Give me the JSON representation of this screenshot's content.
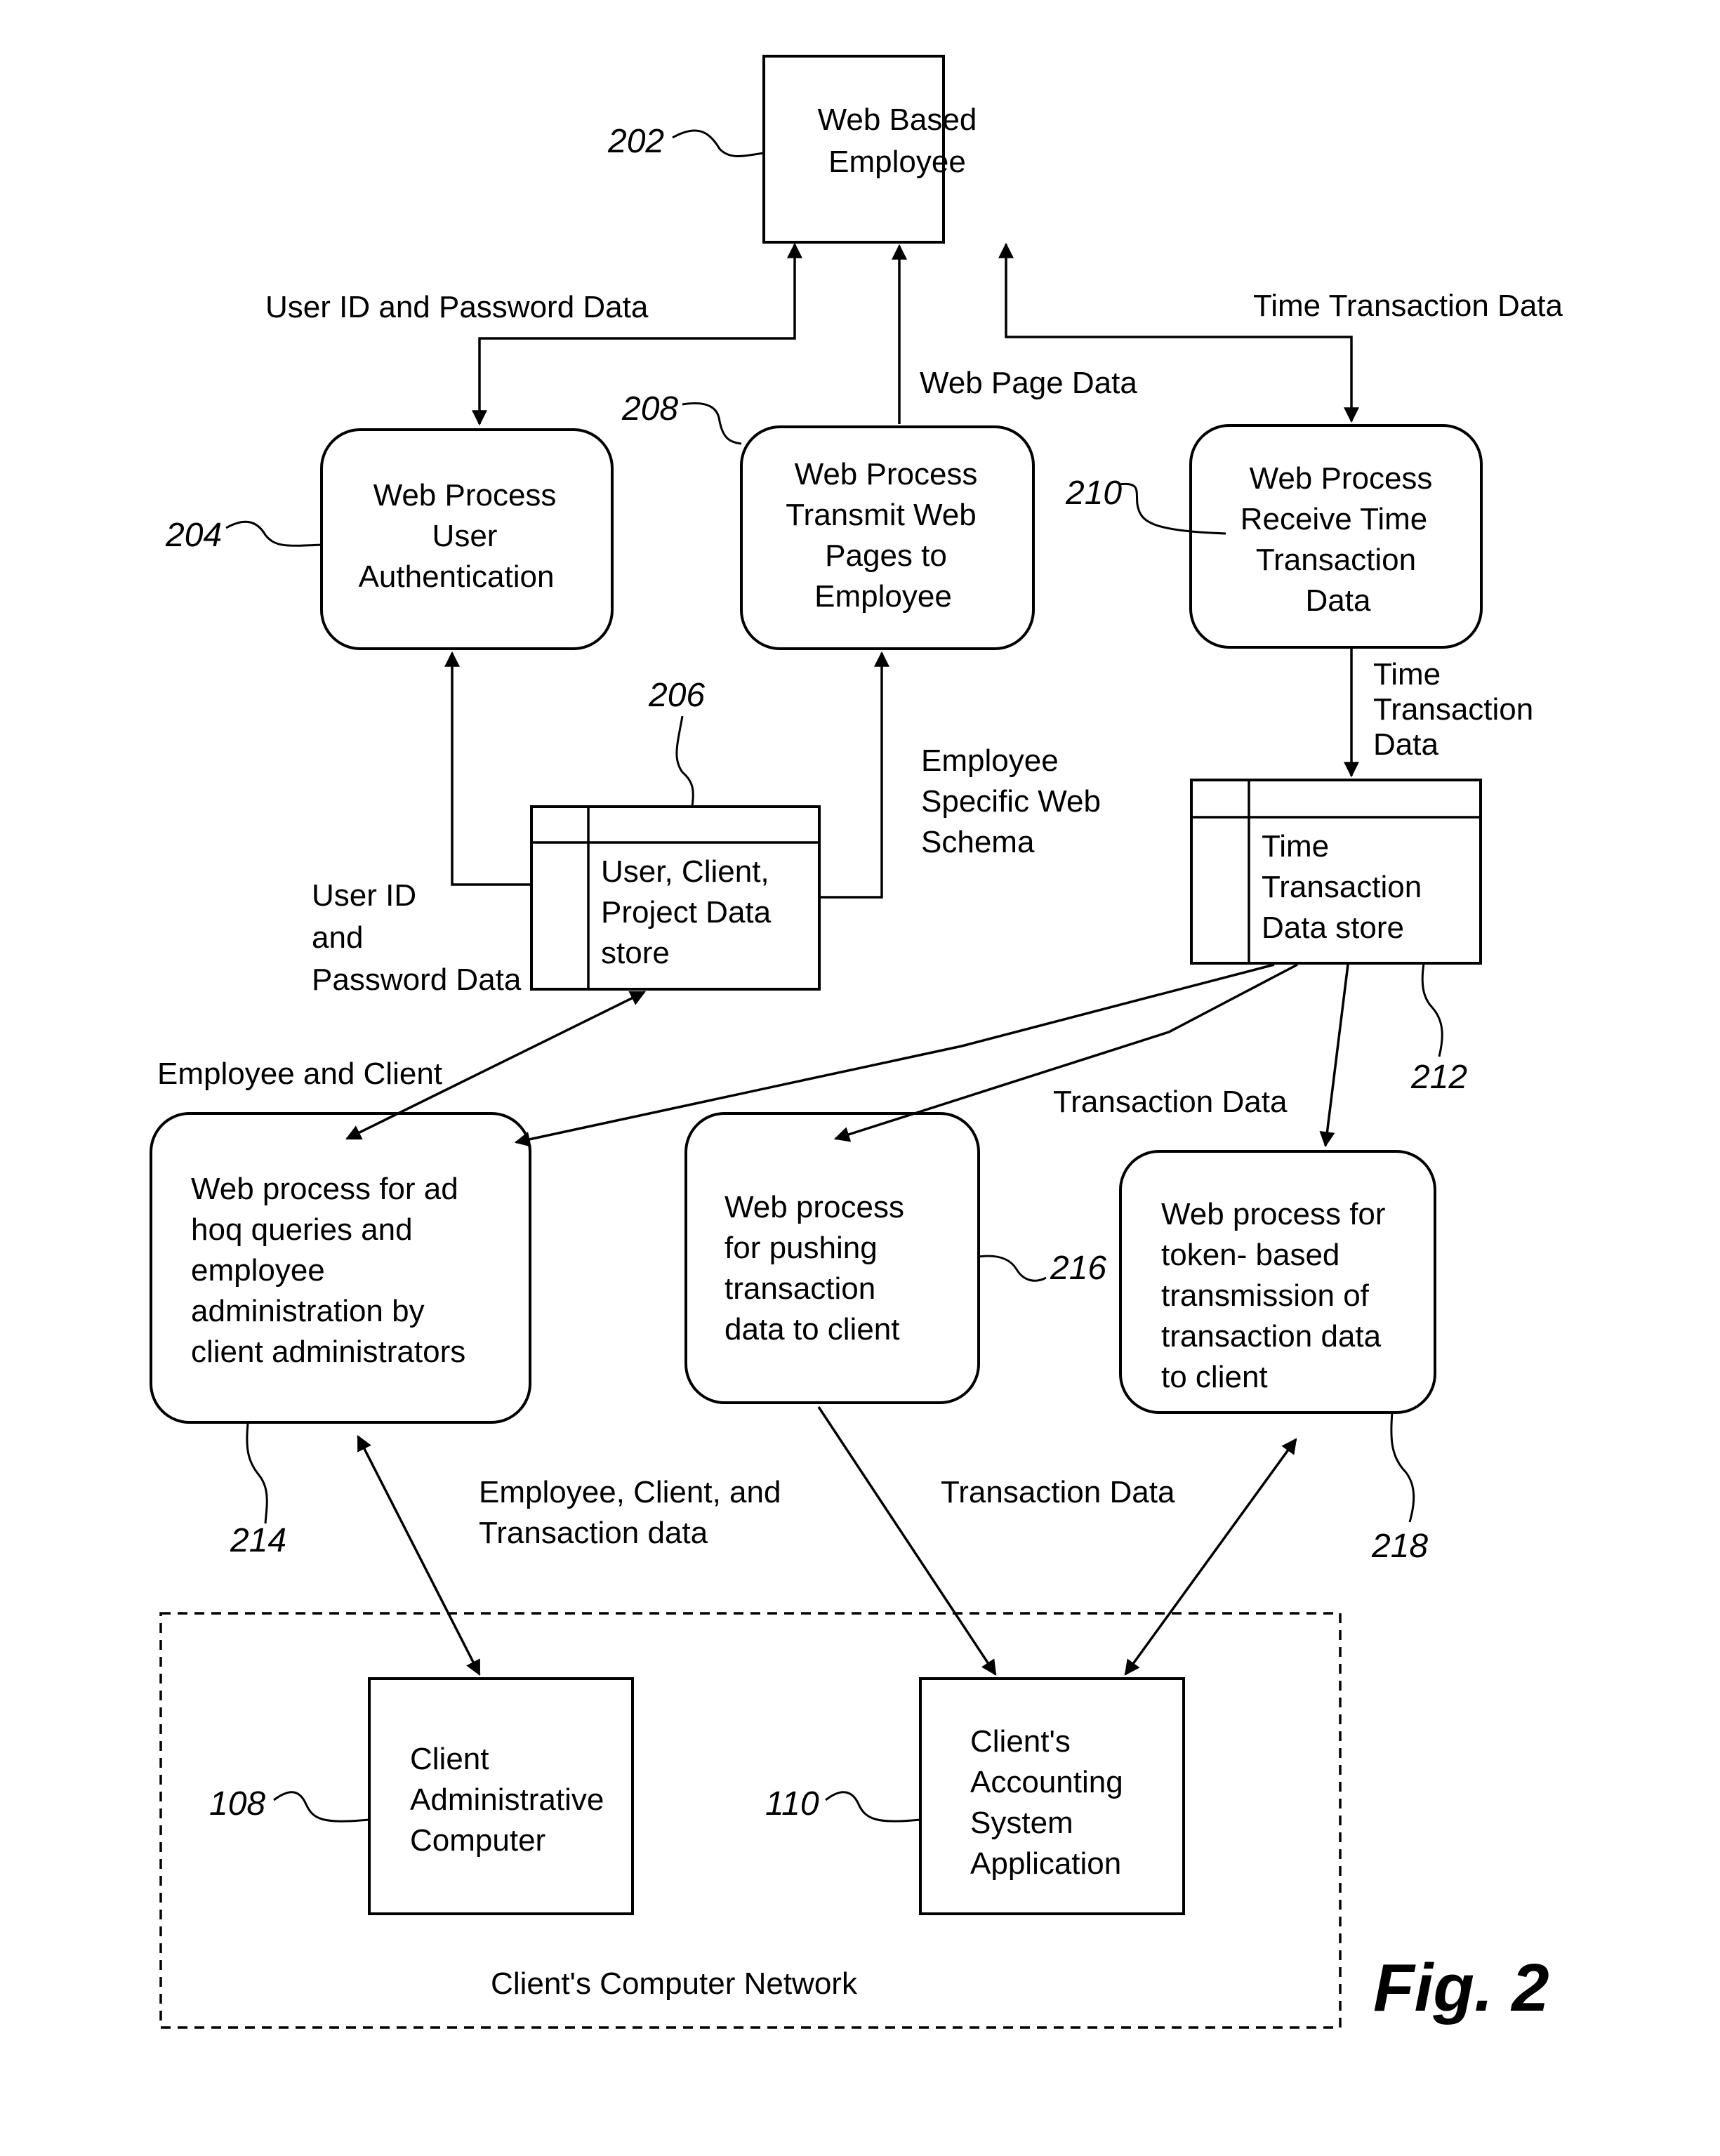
{
  "figure_title": "Fig. 2",
  "nodes": {
    "web_employee": {
      "ref": "202",
      "lines": [
        "Web Based",
        "Employee"
      ]
    },
    "auth": {
      "ref": "204",
      "lines": [
        "Web Process",
        "User",
        "Authentication"
      ]
    },
    "user_store": {
      "ref": "206",
      "lines": [
        "User, Client,",
        "Project Data",
        "store"
      ]
    },
    "transmit": {
      "ref": "208",
      "lines": [
        "Web Process",
        "Transmit Web",
        "Pages to",
        "Employee"
      ]
    },
    "receive": {
      "ref": "210",
      "lines": [
        "Web Process",
        "Receive Time",
        "Transaction",
        "Data"
      ]
    },
    "time_store": {
      "ref": "212",
      "lines": [
        "Time",
        "Transaction",
        "Data store"
      ]
    },
    "adhoc": {
      "ref": "214",
      "lines": [
        "Web process for ad",
        "hoq queries and",
        "employee",
        "administration by",
        "client administrators"
      ]
    },
    "push": {
      "ref": "216",
      "lines": [
        "Web process",
        "for pushing",
        "transaction",
        "data to client"
      ]
    },
    "token": {
      "ref": "218",
      "lines": [
        "Web process for",
        "token- based",
        "transmission of",
        "transaction data",
        "to client"
      ]
    },
    "client_admin": {
      "ref": "108",
      "lines": [
        "Client",
        "Administrative",
        "Computer"
      ]
    },
    "accounting": {
      "ref": "110",
      "lines": [
        "Client's",
        "Accounting",
        "System",
        "Application"
      ]
    }
  },
  "flows": {
    "user_id_password_top": "User ID and Password Data",
    "web_page_data": "Web Page Data",
    "time_transaction_top": "Time Transaction Data",
    "time_transaction_mid": [
      "Time",
      "Transaction",
      "Data"
    ],
    "employee_schema": [
      "Employee",
      "Specific Web",
      "Schema"
    ],
    "user_id_password_side": [
      "User ID",
      "and",
      "Password Data"
    ],
    "employee_and_client": "Employee and Client",
    "transaction_data_mid": "Transaction Data",
    "employee_client_transaction": [
      "Employee, Client, and",
      "Transaction data"
    ],
    "transaction_data_low": "Transaction Data"
  },
  "boundary": {
    "label": "Client's Computer Network"
  }
}
